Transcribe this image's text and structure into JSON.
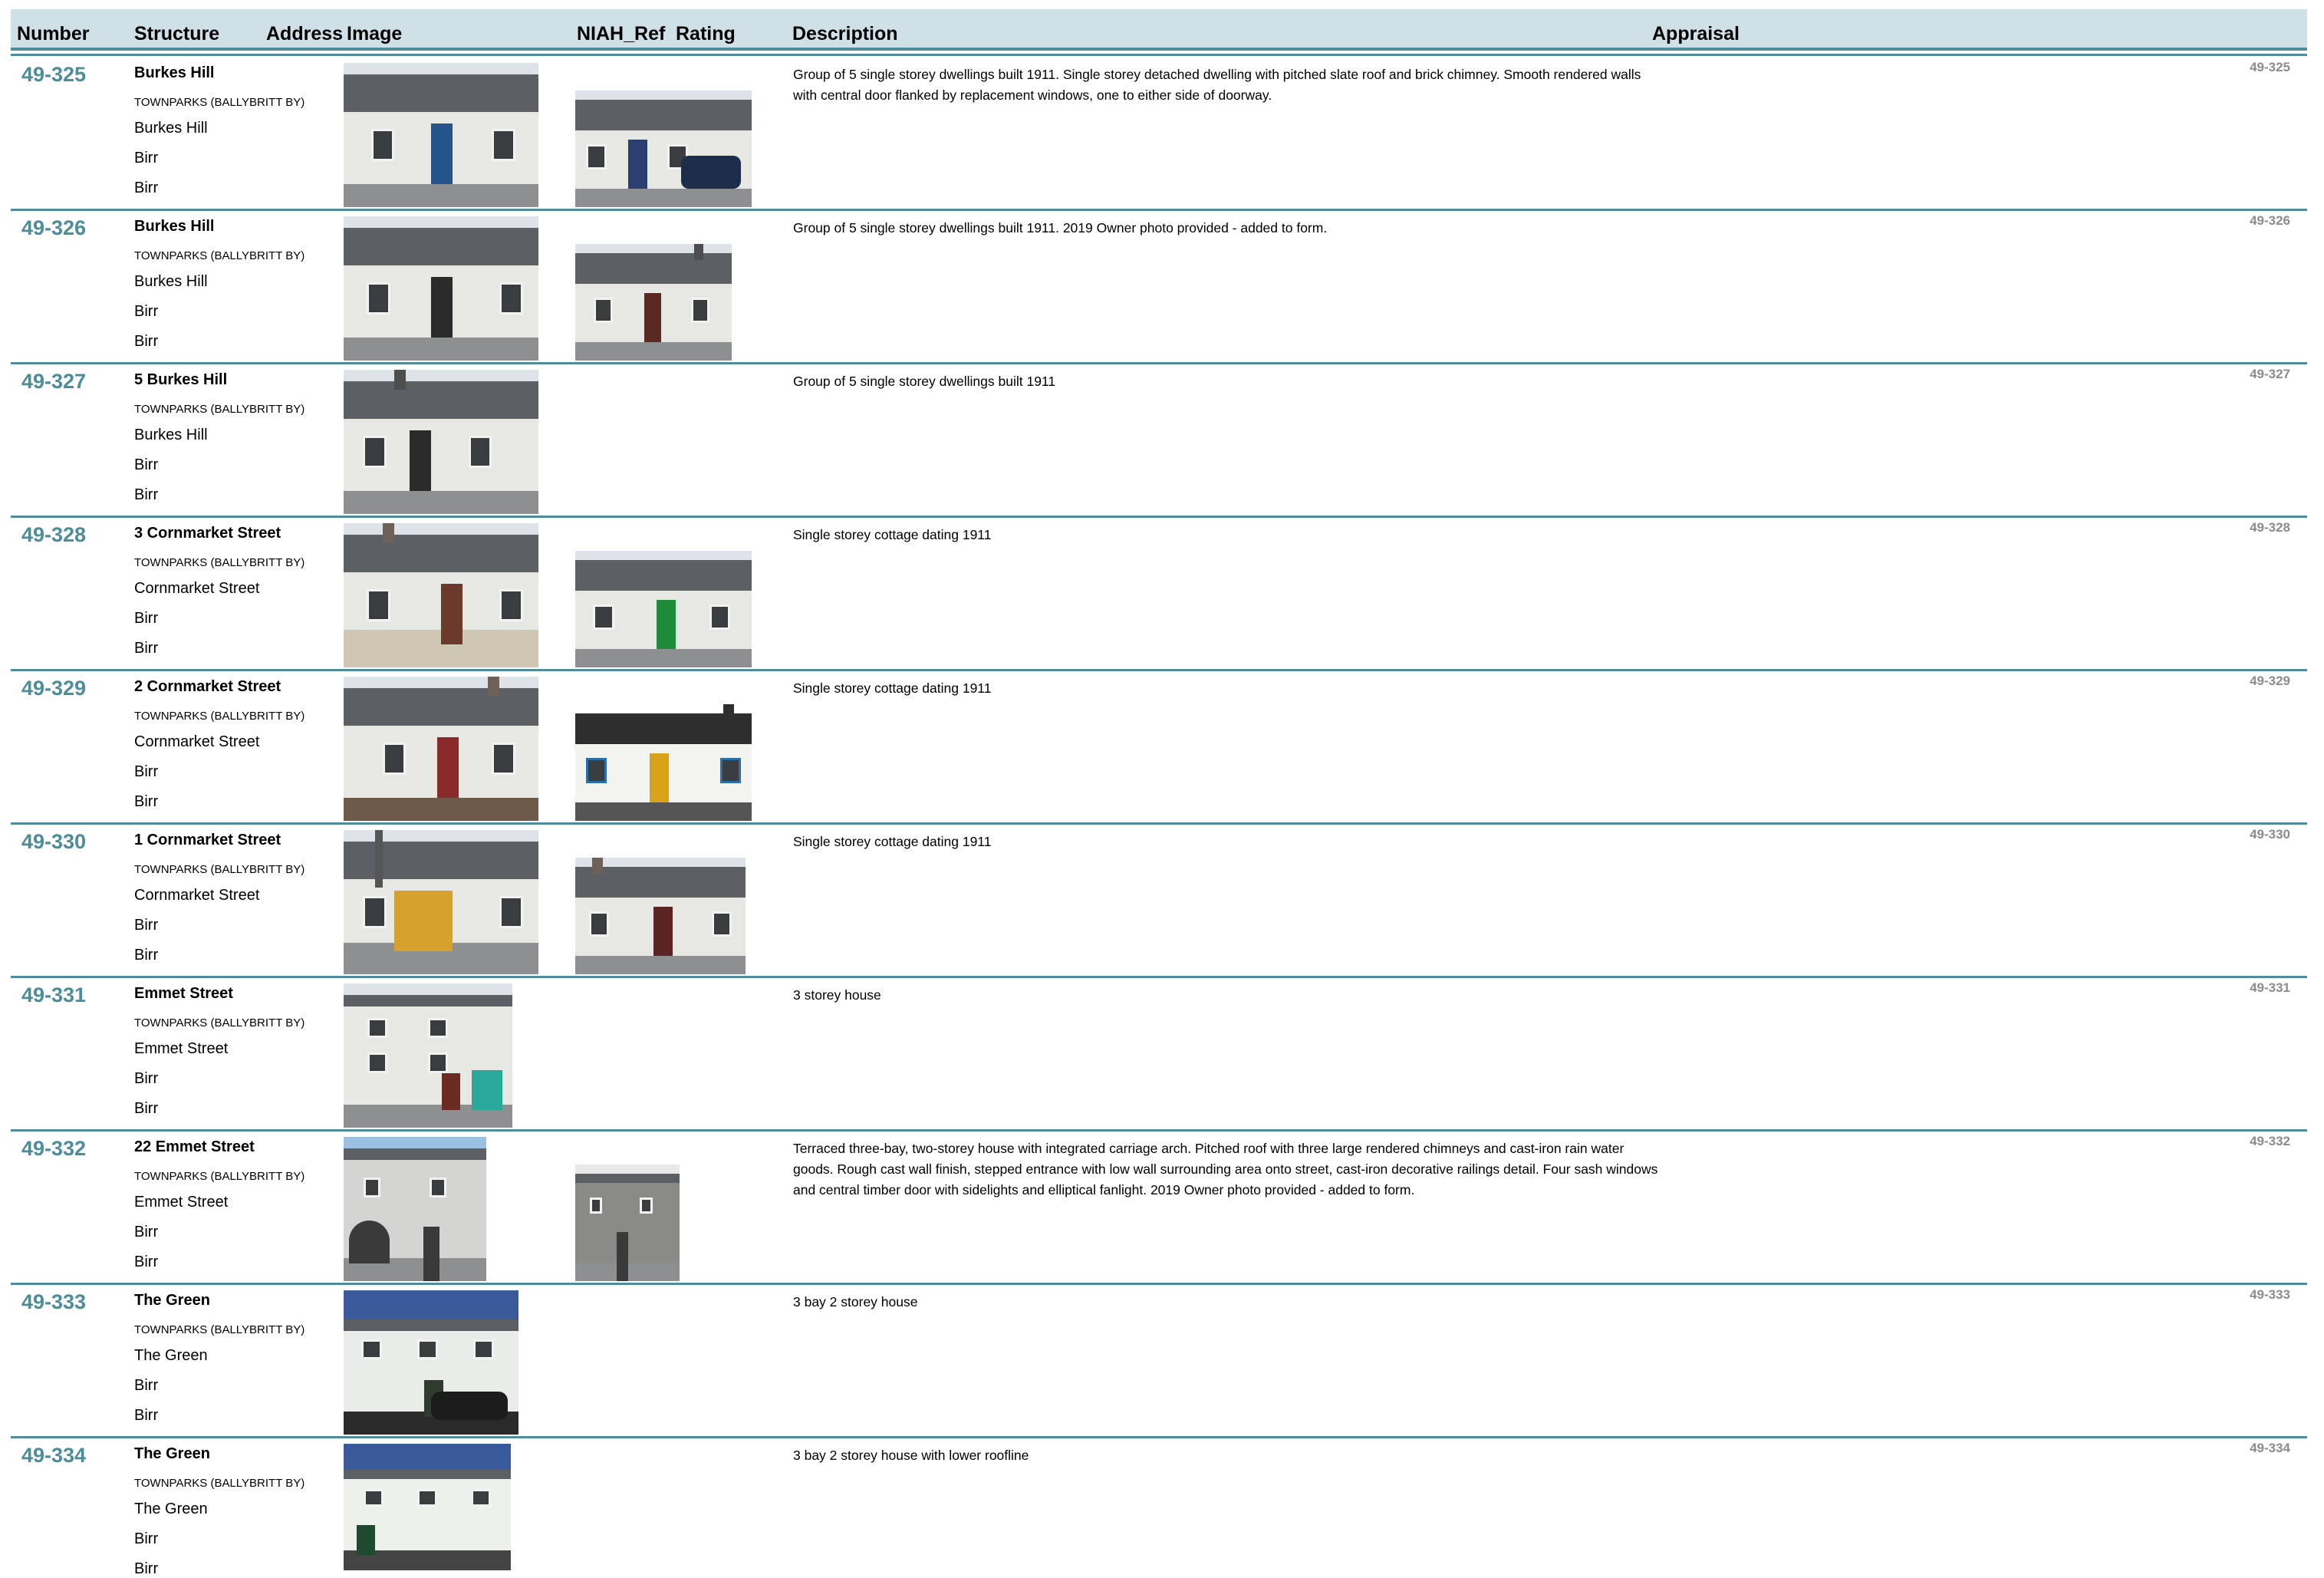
{
  "header": {
    "number": "Number",
    "structure": "Structure",
    "address": "Address",
    "image": "Image",
    "niah_ref": "NIAH_Ref",
    "rating": "Rating",
    "description": "Description",
    "appraisal": "Appraisal"
  },
  "records": [
    {
      "number": "49-325",
      "structure": "Burkes Hill",
      "townland": "TOWNPARKS (BALLYBRITT BY)",
      "address_lines": [
        "Burkes Hill",
        "Birr",
        "Birr"
      ],
      "description": "Group of 5 single storey dwellings built 1911. Single storey detached dwelling with pitched slate roof and brick chimney. Smooth rendered walls with central door flanked by replacement windows, one to either side of doorway.",
      "ref": "49-325",
      "door_color": "#24548a",
      "second_door_color": "#2b3f73"
    },
    {
      "number": "49-326",
      "structure": "Burkes Hill",
      "townland": "TOWNPARKS (BALLYBRITT BY)",
      "address_lines": [
        "Burkes Hill",
        "Birr",
        "Birr"
      ],
      "description": "Group of 5 single storey dwellings built 1911. 2019 Owner photo provided - added to form.",
      "ref": "49-326",
      "door_color": "#2b2b2b",
      "second_door_color": "#5a2a22"
    },
    {
      "number": "49-327",
      "structure": "5 Burkes Hill",
      "townland": "TOWNPARKS (BALLYBRITT BY)",
      "address_lines": [
        "Burkes Hill",
        "Birr",
        "Birr"
      ],
      "description": "Group of 5 single storey dwellings built 1911",
      "ref": "49-327",
      "door_color": "#2b2b2b"
    },
    {
      "number": "49-328",
      "structure": "3 Cornmarket Street",
      "townland": "TOWNPARKS (BALLYBRITT BY)",
      "address_lines": [
        "Cornmarket Street",
        "Birr",
        "Birr"
      ],
      "description": "Single storey cottage dating 1911",
      "ref": "49-328",
      "door_color": "#6b3a2c",
      "second_door_color": "#1f8a3a"
    },
    {
      "number": "49-329",
      "structure": "2 Cornmarket Street",
      "townland": "TOWNPARKS (BALLYBRITT BY)",
      "address_lines": [
        "Cornmarket Street",
        "Birr",
        "Birr"
      ],
      "description": "Single storey cottage dating 1911",
      "ref": "49-329",
      "door_color": "#8a2a2a",
      "second_door_color": "#d9a21a"
    },
    {
      "number": "49-330",
      "structure": "1 Cornmarket Street",
      "townland": "TOWNPARKS (BALLYBRITT BY)",
      "address_lines": [
        "Cornmarket Street",
        "Birr",
        "Birr"
      ],
      "description": "Single storey cottage dating 1911",
      "ref": "49-330",
      "door_color": "#d6a12c",
      "second_door_color": "#5a2424"
    },
    {
      "number": "49-331",
      "structure": "Emmet Street",
      "townland": "TOWNPARKS (BALLYBRITT BY)",
      "address_lines": [
        "Emmet Street",
        "Birr",
        "Birr"
      ],
      "description": "3 storey house",
      "ref": "49-331",
      "door_color": "#2aa89a"
    },
    {
      "number": "49-332",
      "structure": "22 Emmet Street",
      "townland": "TOWNPARKS (BALLYBRITT BY)",
      "address_lines": [
        "Emmet Street",
        "Birr",
        "Birr"
      ],
      "description": "Terraced three-bay, two-storey house with integrated carriage arch. Pitched roof with three large rendered chimneys and cast-iron rain water goods. Rough cast wall finish, stepped entrance with low wall surrounding area onto street, cast-iron decorative railings detail. Four sash windows and central timber door with sidelights and elliptical fanlight. 2019 Owner photo provided - added to form.",
      "ref": "49-332",
      "door_color": "#3a3a3a",
      "second_door_color": "#3a3a3a"
    },
    {
      "number": "49-333",
      "structure": "The Green",
      "townland": "TOWNPARKS (BALLYBRITT BY)",
      "address_lines": [
        "The Green",
        "Birr",
        "Birr"
      ],
      "description": "3 bay 2 storey house",
      "ref": "49-333",
      "door_color": "#2f3b2f"
    },
    {
      "number": "49-334",
      "structure": "The Green",
      "townland": "TOWNPARKS (BALLYBRITT BY)",
      "address_lines": [
        "The Green",
        "Birr",
        "Birr"
      ],
      "description": "3 bay 2 storey house with lower roofline",
      "ref": "49-334",
      "door_color": "#1f4a2f"
    }
  ]
}
